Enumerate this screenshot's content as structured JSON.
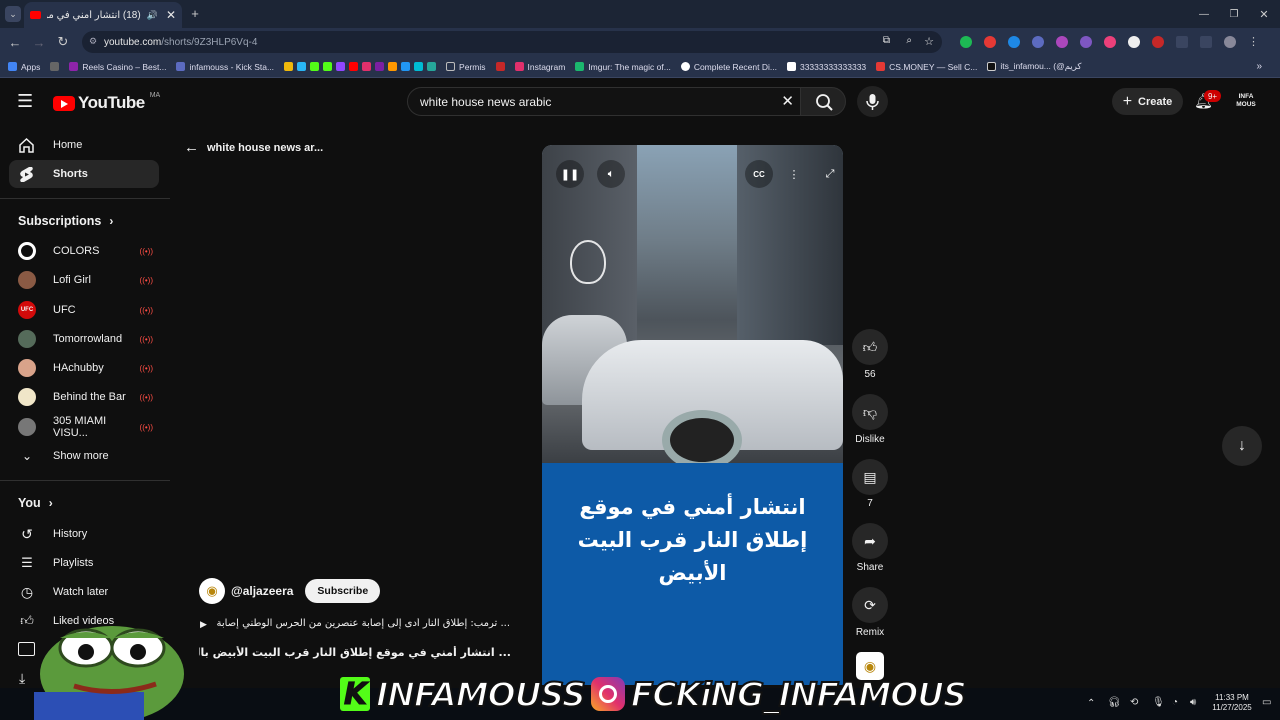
{
  "browser": {
    "tab_title": "(18) انتشار أمني في موقع إ",
    "url_host": "youtube.com",
    "url_path": "/shorts/9Z3HLP6Vq-4",
    "bookmarks": [
      "Apps",
      "Reels Casino – Best...",
      "infamouss - Kick Sta...",
      "Permis",
      "Instagram",
      "Imgur: The magic of...",
      "Complete Recent Di...",
      "33333333333333",
      "CS.MONEY — Sell C...",
      "its_infamou... (@كريم"
    ]
  },
  "youtube": {
    "logo_text": "YouTube",
    "logo_region": "MA",
    "search_value": "white house news arabic",
    "create_label": "Create",
    "notif_count": "9+",
    "avatar_text": "INFA MOUS"
  },
  "sidebar": {
    "nav": [
      {
        "label": "Home",
        "icon": "home-icon"
      },
      {
        "label": "Shorts",
        "icon": "shorts-icon"
      }
    ],
    "subscriptions_title": "Subscriptions",
    "subscriptions": [
      {
        "label": "COLORS",
        "color": "#ffffff"
      },
      {
        "label": "Lofi Girl",
        "color": "#8a5a44"
      },
      {
        "label": "UFC",
        "color": "#d20a0a"
      },
      {
        "label": "Tomorrowland",
        "color": "#556b5a"
      },
      {
        "label": "HAchubby",
        "color": "#d9a38a"
      },
      {
        "label": "Behind the Bar",
        "color": "#f0e6c8"
      },
      {
        "label": "305 MIAMI VISU...",
        "color": "#777777"
      }
    ],
    "show_more": "Show more",
    "you_title": "You",
    "you_items": [
      {
        "label": "History",
        "icon": "history-icon"
      },
      {
        "label": "Playlists",
        "icon": "playlists-icon"
      },
      {
        "label": "Watch later",
        "icon": "watch-later-icon"
      },
      {
        "label": "Liked videos",
        "icon": "like-icon"
      }
    ]
  },
  "shorts": {
    "back_label": "white house news ar...",
    "headline": "انتشار أمني في موقع إطلاق النار قرب البيت الأبيض",
    "actions": [
      {
        "label": "56",
        "icon": "like-icon"
      },
      {
        "label": "Dislike",
        "icon": "dislike-icon"
      },
      {
        "label": "7",
        "icon": "comment-icon"
      },
      {
        "label": "Share",
        "icon": "share-icon"
      },
      {
        "label": "Remix",
        "icon": "remix-icon"
      }
    ],
    "channel": "@aljazeera",
    "subscribe_label": "Subscribe",
    "desc_line1": "... ترمب: إطلاق النار أدى إلى إصابة عنصرين من الحرس الوطني إصابة بالغة",
    "desc_line2": "... انتشار أمني في موقع إطلاق النار قرب البيت الأبيض بالعاصمة"
  },
  "overlay": {
    "kick_name": "INFAMOUSS",
    "ig_name": "FCKiNG_INFAMOUS"
  },
  "taskbar": {
    "time": "11:33 PM",
    "date": "11/27/2025"
  }
}
